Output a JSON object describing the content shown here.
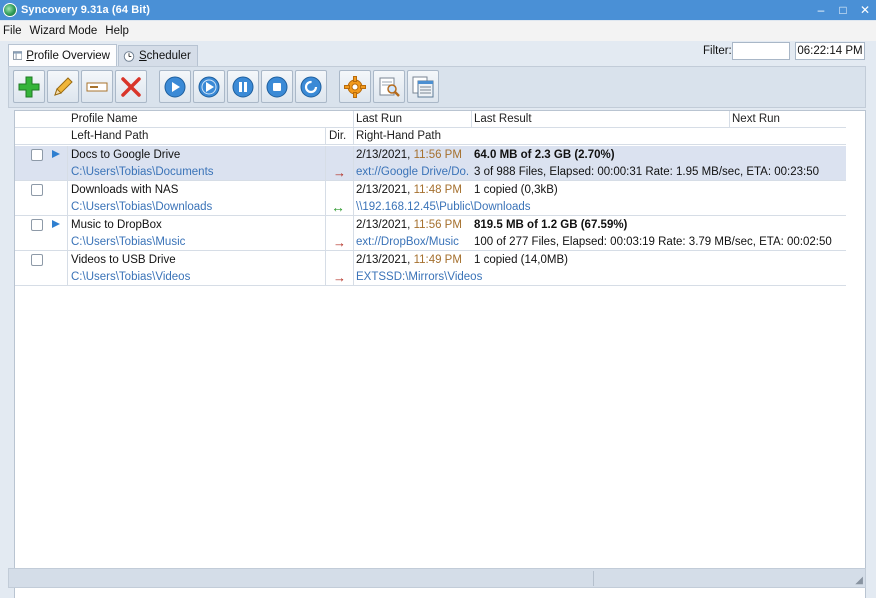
{
  "window": {
    "title": "Syncovery 9.31a (64 Bit)",
    "minimize": "–",
    "maximize": "□",
    "close": "✕"
  },
  "menu": [
    "File",
    "Wizard Mode",
    "Help"
  ],
  "tabs": [
    {
      "label_underlined": "P",
      "label_rest": "rofile Overview"
    },
    {
      "label_underlined": "S",
      "label_rest": "cheduler"
    }
  ],
  "filter": {
    "label": "Filter:",
    "value": ""
  },
  "clock": "06:22:14 PM",
  "toolbar": [
    "add-icon",
    "edit-icon",
    "rename-icon",
    "delete-icon",
    "run-icon",
    "run-attended-icon",
    "pause-icon",
    "stop-icon",
    "refresh-icon",
    "settings-icon",
    "log-search-icon",
    "log-list-icon"
  ],
  "columns": {
    "profile_name": "Profile Name",
    "left_path": "Left-Hand Path",
    "dir": "Dir.",
    "last_run": "Last Run",
    "right_path": "Right-Hand Path",
    "last_result": "Last Result",
    "next_run": "Next Run"
  },
  "profiles": [
    {
      "name": "Docs to Google Drive",
      "left": "C:\\Users\\Tobias\\Documents",
      "direction": "→",
      "date": "2/13/2021,",
      "time": "11:56 PM",
      "right": "ext://Google Drive/Do...",
      "result1": "64.0 MB of 2.3 GB (2.70%)",
      "result2": "3 of 988 Files, Elapsed: 00:00:31  Rate: 1.95 MB/sec, ETA: 00:23:50",
      "running": true,
      "selected": true
    },
    {
      "name": "Downloads with NAS",
      "left": "C:\\Users\\Tobias\\Downloads",
      "direction": "↔",
      "date": "2/13/2021,",
      "time": "11:48 PM",
      "right": "\\\\192.168.12.45\\Public\\Downloads",
      "result1": "1 copied (0,3kB)",
      "result2": "",
      "running": false,
      "selected": false
    },
    {
      "name": "Music to DropBox",
      "left": "C:\\Users\\Tobias\\Music",
      "direction": "→",
      "date": "2/13/2021,",
      "time": "11:56 PM",
      "right": "ext://DropBox/Music",
      "result1": "819.5 MB of 1.2 GB (67.59%)",
      "result2": "100 of 277 Files, Elapsed: 00:03:19  Rate: 3.79 MB/sec, ETA: 00:02:50",
      "running": true,
      "selected": false
    },
    {
      "name": "Videos to USB Drive",
      "left": "C:\\Users\\Tobias\\Videos",
      "direction": "→",
      "date": "2/13/2021,",
      "time": "11:49 PM",
      "right": "EXTSSD:\\Mirrors\\Videos",
      "result1": "1 copied (14,0MB)",
      "result2": "",
      "running": false,
      "selected": false
    }
  ],
  "colors": {
    "titlebar": "#4a90d6",
    "path_blue": "#3a73b8",
    "time_brown": "#a5702e",
    "arrow_red": "#b0281c",
    "arrow_green": "#2f9a2f",
    "selection": "#dbe2f0"
  }
}
